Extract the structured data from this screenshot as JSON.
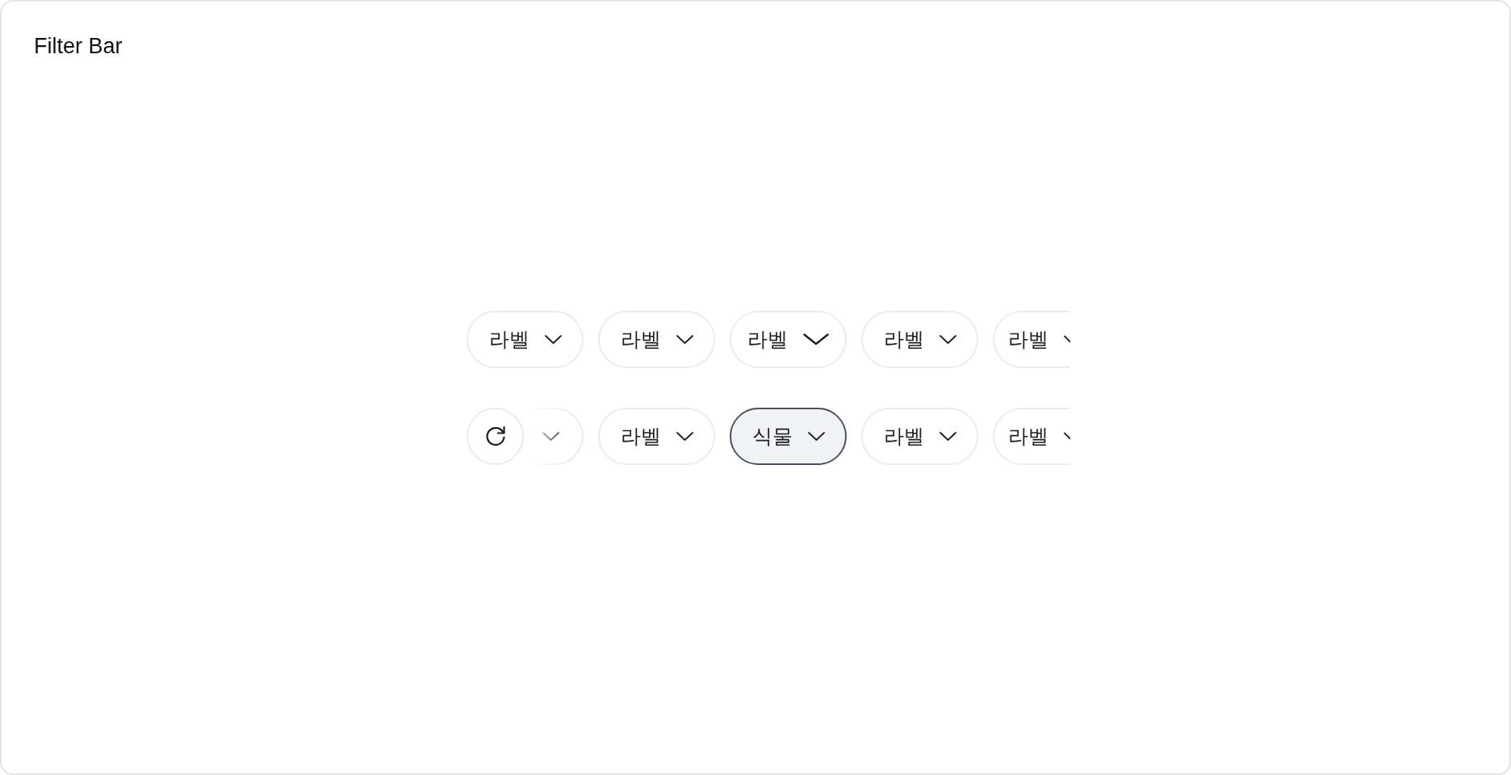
{
  "title": "Filter Bar",
  "rows": [
    {
      "chips": [
        {
          "kind": "chip",
          "label": "라벨",
          "selected": false,
          "hovered": false
        },
        {
          "kind": "chip",
          "label": "라벨",
          "selected": false,
          "hovered": false
        },
        {
          "kind": "chip",
          "label": "라벨",
          "selected": false,
          "hovered": true
        },
        {
          "kind": "chip",
          "label": "라벨",
          "selected": false,
          "hovered": false
        },
        {
          "kind": "cut",
          "label": "라벨",
          "selected": false,
          "hovered": false
        }
      ]
    },
    {
      "reset": true,
      "chips": [
        {
          "kind": "tail",
          "selected": false,
          "hovered": false
        },
        {
          "kind": "chip",
          "label": "라벨",
          "selected": false,
          "hovered": false
        },
        {
          "kind": "chip",
          "label": "식물",
          "selected": true,
          "hovered": false
        },
        {
          "kind": "chip",
          "label": "라벨",
          "selected": false,
          "hovered": false
        },
        {
          "kind": "cut",
          "label": "라벨",
          "selected": false,
          "hovered": false
        }
      ]
    }
  ]
}
